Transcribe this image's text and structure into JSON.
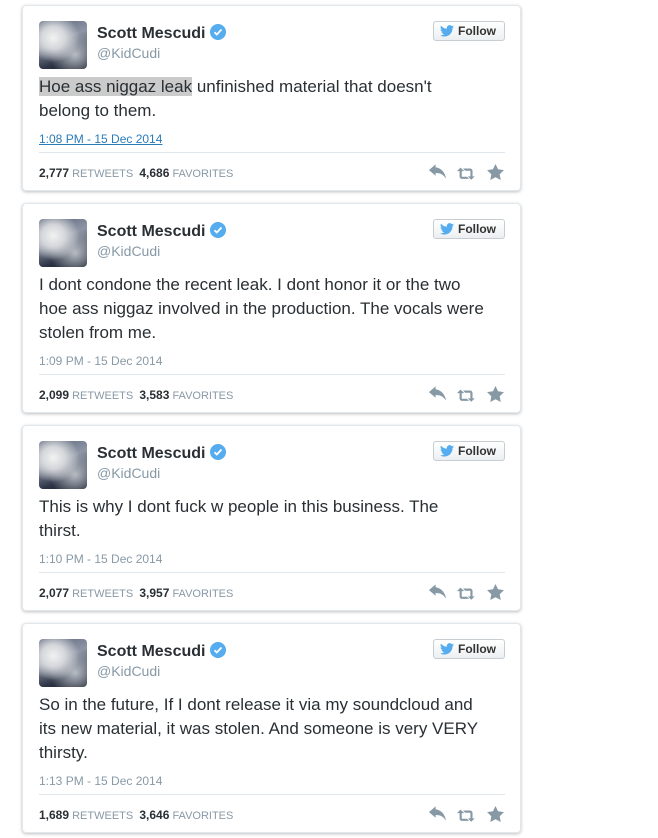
{
  "colors": {
    "name": "#292f33",
    "muted": "#8899a6",
    "link": "#2b7bb9",
    "twitter_blue": "#55acee",
    "verified": "#55acee",
    "action_icon": "#8899a6"
  },
  "tweets": [
    {
      "name": "Scott Mescudi",
      "handle": "@KidCudi",
      "follow_label": "Follow",
      "text_highlight": "Hoe ass niggaz leak",
      "text": " unfinished material that doesn't belong to them.",
      "timestamp": "1:08 PM - 15 Dec 2014",
      "retweets": "2,777",
      "retweets_label": "RETWEETS",
      "favorites": "4,686",
      "favorites_label": "FAVORITES"
    },
    {
      "name": "Scott Mescudi",
      "handle": "@KidCudi",
      "follow_label": "Follow",
      "text": "I dont condone the recent leak. I dont honor it or the two hoe ass niggaz involved in the production.  The vocals were stolen from me.",
      "timestamp": "1:09 PM - 15 Dec 2014",
      "retweets": "2,099",
      "retweets_label": "RETWEETS",
      "favorites": "3,583",
      "favorites_label": "FAVORITES"
    },
    {
      "name": "Scott Mescudi",
      "handle": "@KidCudi",
      "follow_label": "Follow",
      "text": "This is why I dont fuck w people in this business.  The thirst.",
      "timestamp": "1:10 PM - 15 Dec 2014",
      "retweets": "2,077",
      "retweets_label": "RETWEETS",
      "favorites": "3,957",
      "favorites_label": "FAVORITES"
    },
    {
      "name": "Scott Mescudi",
      "handle": "@KidCudi",
      "follow_label": "Follow",
      "text": "So in the future, If I dont release it via my soundcloud and its new material, it was stolen.  And someone is very VERY thirsty.",
      "timestamp": "1:13 PM - 15 Dec 2014",
      "retweets": "1,689",
      "retweets_label": "RETWEETS",
      "favorites": "3,646",
      "favorites_label": "FAVORITES"
    }
  ]
}
